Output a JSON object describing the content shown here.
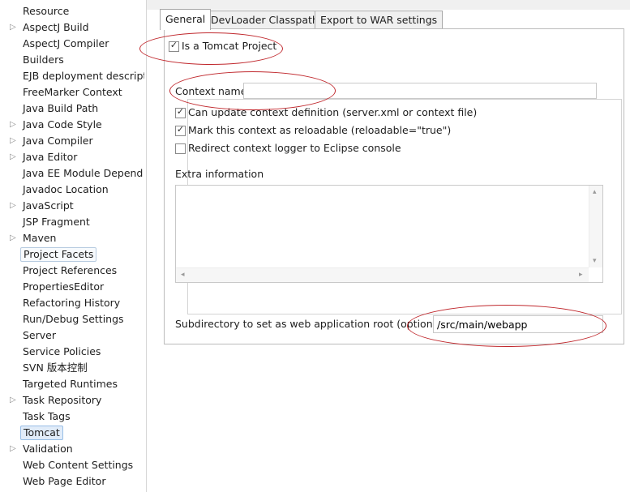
{
  "tree": {
    "items": [
      {
        "label": "Resource",
        "arrow": ""
      },
      {
        "label": "AspectJ Build",
        "arrow": "▷"
      },
      {
        "label": "AspectJ Compiler",
        "arrow": ""
      },
      {
        "label": "Builders",
        "arrow": ""
      },
      {
        "label": "EJB deployment descript",
        "arrow": ""
      },
      {
        "label": "FreeMarker Context",
        "arrow": ""
      },
      {
        "label": "Java Build Path",
        "arrow": ""
      },
      {
        "label": "Java Code Style",
        "arrow": "▷"
      },
      {
        "label": "Java Compiler",
        "arrow": "▷"
      },
      {
        "label": "Java Editor",
        "arrow": "▷"
      },
      {
        "label": "Java EE Module Depend",
        "arrow": ""
      },
      {
        "label": "Javadoc Location",
        "arrow": ""
      },
      {
        "label": "JavaScript",
        "arrow": "▷"
      },
      {
        "label": "JSP Fragment",
        "arrow": ""
      },
      {
        "label": "Maven",
        "arrow": "▷"
      },
      {
        "label": "Project Facets",
        "arrow": ""
      },
      {
        "label": "Project References",
        "arrow": ""
      },
      {
        "label": "PropertiesEditor",
        "arrow": ""
      },
      {
        "label": "Refactoring History",
        "arrow": ""
      },
      {
        "label": "Run/Debug Settings",
        "arrow": ""
      },
      {
        "label": "Server",
        "arrow": ""
      },
      {
        "label": "Service Policies",
        "arrow": ""
      },
      {
        "label": "SVN 版本控制",
        "arrow": ""
      },
      {
        "label": "Targeted Runtimes",
        "arrow": ""
      },
      {
        "label": "Task Repository",
        "arrow": "▷"
      },
      {
        "label": "Task Tags",
        "arrow": ""
      },
      {
        "label": "Tomcat",
        "arrow": ""
      },
      {
        "label": "Validation",
        "arrow": "▷"
      },
      {
        "label": "Web Content Settings",
        "arrow": ""
      },
      {
        "label": "Web Page Editor",
        "arrow": ""
      }
    ]
  },
  "tabs": {
    "general": "General",
    "devloader": "DevLoader Classpath",
    "war": "Export to WAR settings"
  },
  "general": {
    "is_tomcat_project": {
      "label": "Is a Tomcat Project",
      "checked": true
    },
    "context_name": {
      "label": "Context name",
      "value": ""
    },
    "can_update": {
      "label": "Can update context definition (server.xml or context file)",
      "checked": true
    },
    "reloadable": {
      "label": "Mark this context as reloadable (reloadable=\"true\")",
      "checked": true
    },
    "redirect_logger": {
      "label": "Redirect context logger to Eclipse console",
      "checked": false
    },
    "extra_information": {
      "label": "Extra information",
      "value": ""
    },
    "webapp_root": {
      "label": "Subdirectory to set as web application root (optional)",
      "value": "/src/main/webapp"
    }
  },
  "glyphs": {
    "check": "✓",
    "up": "▴",
    "down": "▾",
    "left": "◂",
    "right": "▸"
  },
  "annotation_color": "#c0282d"
}
